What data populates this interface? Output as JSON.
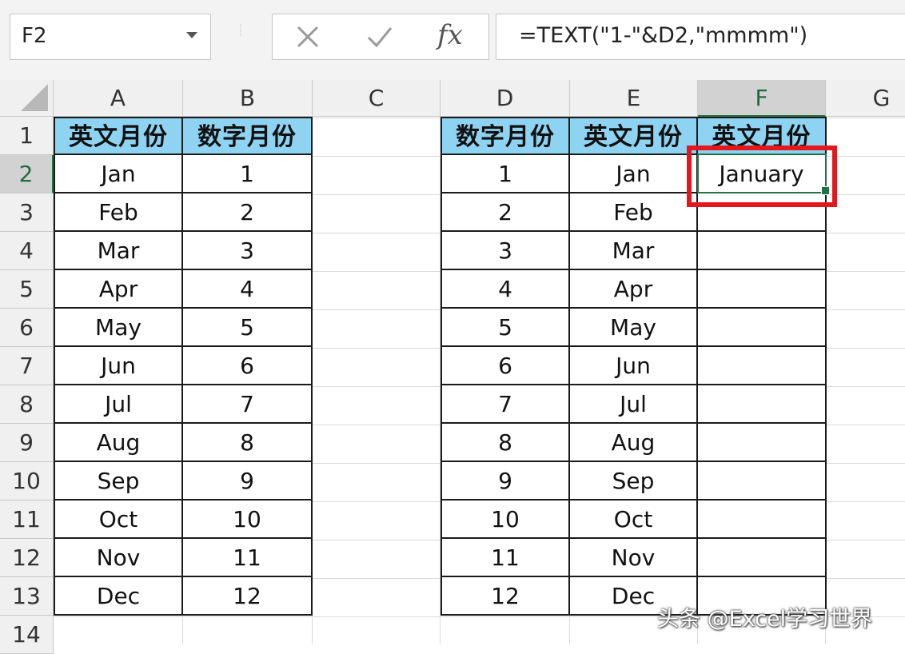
{
  "name_box": {
    "value": "F2"
  },
  "formula_bar": {
    "fx_label": "fx",
    "formula": "=TEXT(\"1-\"&D2,\"mmmm\")"
  },
  "columns": [
    "A",
    "B",
    "C",
    "D",
    "E",
    "F",
    "G"
  ],
  "rows": [
    "1",
    "2",
    "3",
    "4",
    "5",
    "6",
    "7",
    "8",
    "9",
    "10",
    "11",
    "12",
    "13",
    "14"
  ],
  "headers": {
    "A": "英文月份",
    "B": "数字月份",
    "D": "数字月份",
    "E": "英文月份",
    "F": "英文月份"
  },
  "table_left": {
    "english": [
      "Jan",
      "Feb",
      "Mar",
      "Apr",
      "May",
      "Jun",
      "Jul",
      "Aug",
      "Sep",
      "Oct",
      "Nov",
      "Dec"
    ],
    "numbers": [
      "1",
      "2",
      "3",
      "4",
      "5",
      "6",
      "7",
      "8",
      "9",
      "10",
      "11",
      "12"
    ]
  },
  "table_right": {
    "numbers": [
      "1",
      "2",
      "3",
      "4",
      "5",
      "6",
      "7",
      "8",
      "9",
      "10",
      "11",
      "12"
    ],
    "english": [
      "Jan",
      "Feb",
      "Mar",
      "Apr",
      "May",
      "Jun",
      "Jul",
      "Aug",
      "Sep",
      "Oct",
      "Nov",
      "Dec"
    ],
    "result": [
      "January",
      "",
      "",
      "",
      "",
      "",
      "",
      "",
      "",
      "",
      "",
      ""
    ]
  },
  "active_cell": "F2",
  "watermark": "头条 @Excel学习世界",
  "colors": {
    "header_fill": "#8fd3f3",
    "highlight": "#e3181c",
    "accent": "#217346"
  }
}
